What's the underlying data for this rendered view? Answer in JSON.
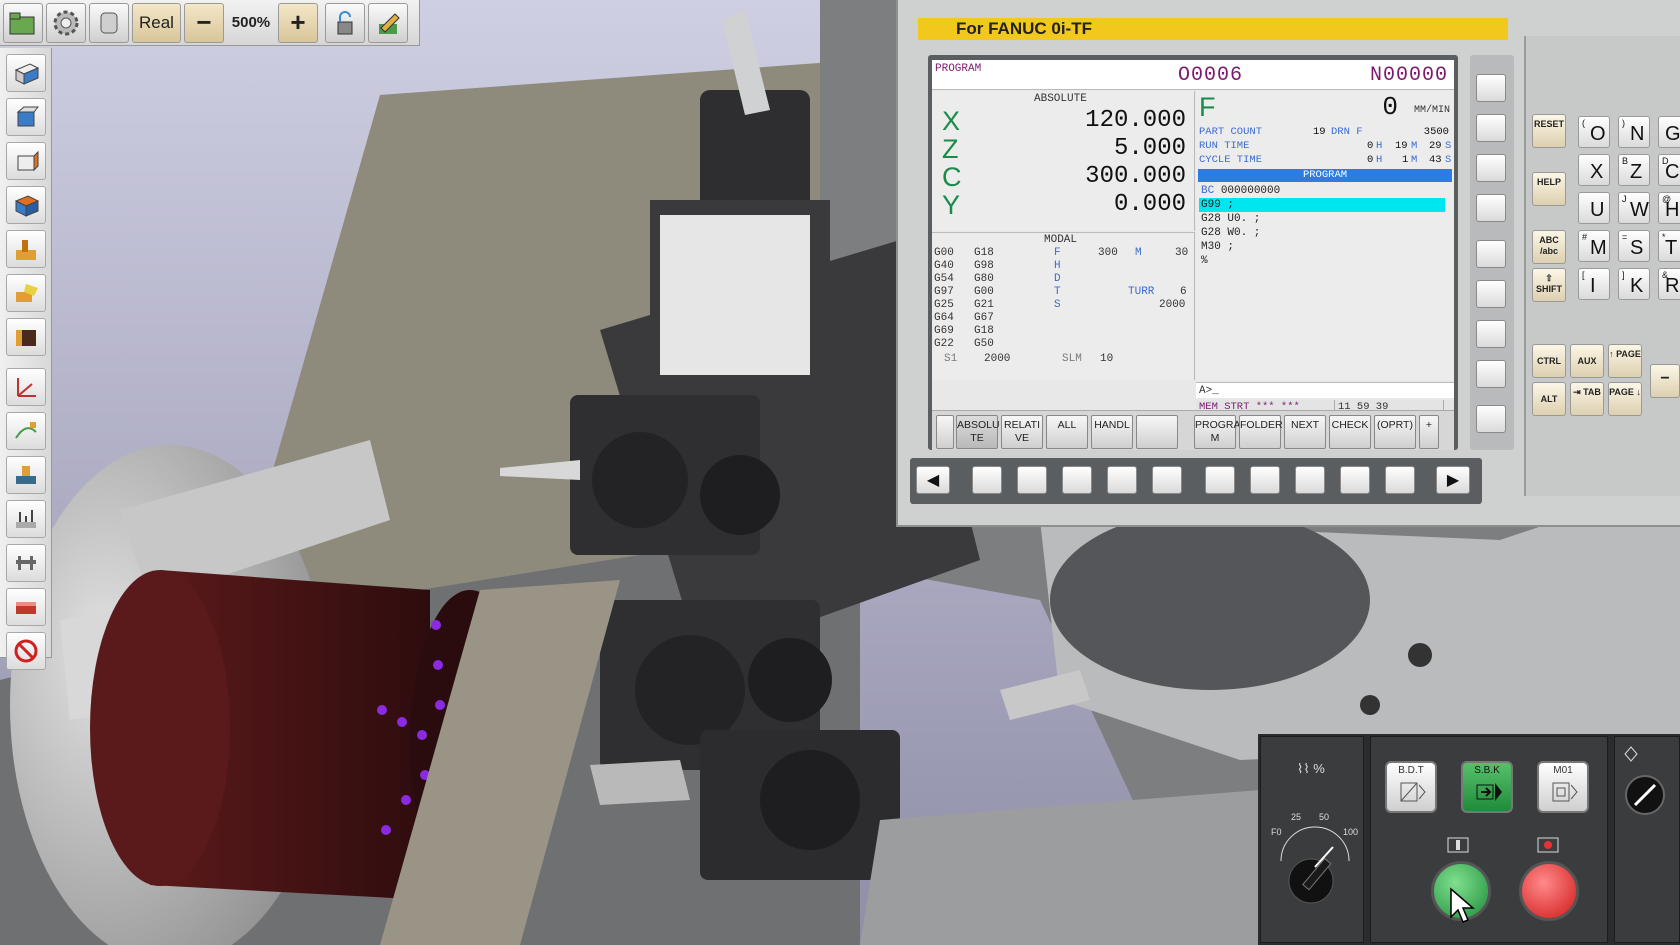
{
  "toolbar": {
    "mode_label": "Real",
    "zoom_minus": "−",
    "zoom_value": "500%",
    "zoom_plus": "+"
  },
  "panel": {
    "title": "For FANUC 0i-TF"
  },
  "screen": {
    "program_label": "PROGRAM",
    "o_number": "O0006",
    "n_number": "N00000",
    "absolute_title": "ABSOLUTE",
    "axes": [
      {
        "name": "X",
        "value": "120.000"
      },
      {
        "name": "Z",
        "value": "5.000"
      },
      {
        "name": "C",
        "value": "300.000"
      },
      {
        "name": "Y",
        "value": "0.000"
      }
    ],
    "modal_title": "MODAL",
    "modal_g_col1": [
      "G00",
      "G40",
      "G54",
      "G97",
      "G25",
      "G64",
      "G69",
      "G22"
    ],
    "modal_g_col2": [
      "G18",
      "G98",
      "G80",
      "G00",
      "G21",
      "G67",
      "G18",
      "G50"
    ],
    "modal_letters": [
      "F",
      "H",
      "D",
      "T",
      "S"
    ],
    "modal_f": "300",
    "modal_m_label": "M",
    "modal_m": "30",
    "modal_turr_label": "TURR",
    "modal_turr": "6",
    "modal_s": "2000",
    "s1_label": "S1",
    "s1_value": "2000",
    "slm_label": "SLM",
    "slm_value": "10",
    "feed_label": "F",
    "feed_value": "0",
    "feed_unit": "MM/MIN",
    "part_count_label": "PART COUNT",
    "part_count": "19",
    "drn_label": "DRN F",
    "drn_value": "3500",
    "run_time_label": "RUN TIME",
    "run_h": "0",
    "run_m": "19",
    "run_s": "29",
    "cycle_time_label": "CYCLE TIME",
    "cycle_h": "0",
    "cycle_m": "1",
    "cycle_s": "43",
    "unit_h": "H",
    "unit_m": "M",
    "unit_s": "S",
    "program_bar": "PROGRAM",
    "program_bc_label": "BC",
    "program_bc": "000000000",
    "program_lines": [
      "G99 ;",
      "G28 U0. ;",
      "G28 W0. ;",
      "M30 ;",
      "%"
    ],
    "input_prompt": "A>_",
    "status_mode": "MEM STRT *** ***",
    "status_clock": "11 59 39",
    "softkeys": [
      "ABSOLU TE",
      "RELATI VE",
      "ALL",
      "HANDL",
      "",
      "PROGRA M",
      "FOLDER",
      "NEXT",
      "CHECK",
      "(OPRT)",
      "+"
    ]
  },
  "mdi_keys": [
    {
      "small": "(",
      "big": "O"
    },
    {
      "small": ")",
      "big": "N"
    },
    {
      "small": "",
      "big": "G"
    },
    {
      "small": "",
      "big": "X"
    },
    {
      "small": "B",
      "big": "Z"
    },
    {
      "small": "D",
      "big": "C"
    },
    {
      "small": "",
      "big": "U"
    },
    {
      "small": "J",
      "big": "W"
    },
    {
      "small": "@",
      "big": "H"
    },
    {
      "small": "#",
      "big": "M"
    },
    {
      "small": "=",
      "big": "S"
    },
    {
      "small": "*",
      "big": "T"
    },
    {
      "small": "[",
      "big": "I"
    },
    {
      "small": "]",
      "big": "K"
    },
    {
      "small": "&",
      "big": "R"
    }
  ],
  "function_keys": {
    "reset": "RESET",
    "help": "HELP",
    "abc": "ABC /abc",
    "shift": "⇧ SHIFT",
    "ctrl": "CTRL",
    "aux": "AUX",
    "page_up": "↑ PAGE",
    "alt": "ALT",
    "tab": "⇥ TAB",
    "page_down": "PAGE ↓",
    "minus": "−"
  },
  "operator": {
    "feed_override_label": "⌇⌇ %",
    "dial_labels": [
      "F0",
      "25",
      "50",
      "100"
    ],
    "bdt": "B.D.T",
    "sbk": "S.B.K",
    "m01": "M01"
  },
  "colors": {
    "panel_title_bg": "#f2c81c",
    "axis_green": "#1a8c4a",
    "program_bar": "#2f7ce0",
    "highlight_line": "#00e6ee",
    "cycle_start": "#2fa34d",
    "feed_hold": "#e83232"
  }
}
